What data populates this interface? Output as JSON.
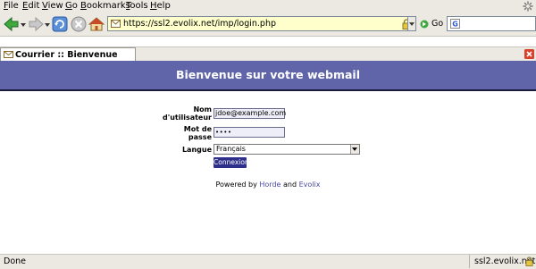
{
  "menu": [
    {
      "label": "File",
      "acc": "F",
      "rest": "ile"
    },
    {
      "label": "Edit",
      "acc": "E",
      "rest": "dit"
    },
    {
      "label": "View",
      "acc": "V",
      "rest": "iew"
    },
    {
      "label": "Go",
      "acc": "G",
      "rest": "o"
    },
    {
      "label": "Bookmarks",
      "acc": "B",
      "rest": "ookmarks"
    },
    {
      "label": "Tools",
      "acc": "T",
      "rest": "ools"
    },
    {
      "label": "Help",
      "acc": "H",
      "rest": "elp"
    }
  ],
  "toolbar": {
    "url": "https://ssl2.evolix.net/imp/login.php",
    "go_label": "Go",
    "search_value": ""
  },
  "tab": {
    "title": "Courrier :: Bienvenue sur vo..."
  },
  "page": {
    "header_title": "Bienvenue sur votre webmail",
    "username_label_line1": "Nom",
    "username_label_line2": "d'utilisateur",
    "username_value": "jdoe@example.com",
    "password_label_line1": "Mot de",
    "password_label_line2": "passe",
    "password_value": "••••",
    "language_label": "Langue",
    "language_value": "Français",
    "login_button": "Connexion",
    "powered_prefix": "Powered by",
    "powered_horde": "Horde",
    "powered_and": "and",
    "powered_evolix": "Evolix"
  },
  "status": {
    "text": "Done",
    "domain": "ssl2.evolix.net"
  },
  "colors": {
    "header_bg": "#6065a9",
    "login_button_bg": "#2e2f8a",
    "url_bg": "#ffffcc",
    "chrome_bg": "#ece9e3"
  }
}
